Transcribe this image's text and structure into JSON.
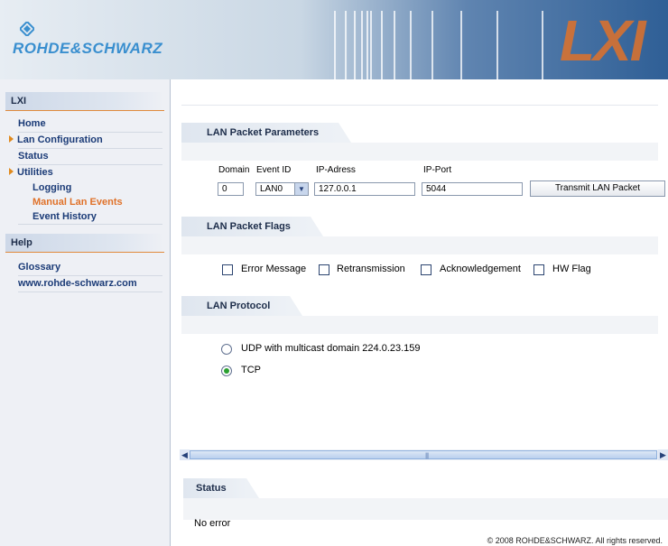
{
  "header": {
    "brand": "ROHDE&SCHWARZ",
    "badge": "LXI"
  },
  "sidebar": {
    "section1": "LXI",
    "items": [
      {
        "label": "Home"
      },
      {
        "label": "Lan Configuration"
      },
      {
        "label": "Status"
      },
      {
        "label": "Utilities"
      },
      {
        "label": "Logging"
      },
      {
        "label": "Manual Lan Events"
      },
      {
        "label": "Event History"
      }
    ],
    "section2": "Help",
    "help_items": [
      {
        "label": "Glossary"
      },
      {
        "label": "www.rohde-schwarz.com"
      }
    ]
  },
  "packet_params": {
    "title": "LAN Packet Parameters",
    "domain_label": "Domain",
    "event_label": "Event ID",
    "ip_label": "IP-Adress",
    "port_label": "IP-Port",
    "domain_value": "0",
    "event_value": "LAN0",
    "ip_value": "127.0.0.1",
    "port_value": "5044",
    "transmit_label": "Transmit LAN Packet"
  },
  "packet_flags": {
    "title": "LAN Packet Flags",
    "flags": [
      "Error Message",
      "Retransmission",
      "Acknowledgement",
      "HW Flag"
    ]
  },
  "protocol": {
    "title": "LAN Protocol",
    "udp_label": "UDP with multicast domain 224.0.23.159",
    "tcp_label": "TCP",
    "selected": "TCP"
  },
  "status": {
    "title": "Status",
    "message": "No error"
  },
  "footer": {
    "copyright": "© 2008 ROHDE&SCHWARZ. All rights reserved."
  }
}
